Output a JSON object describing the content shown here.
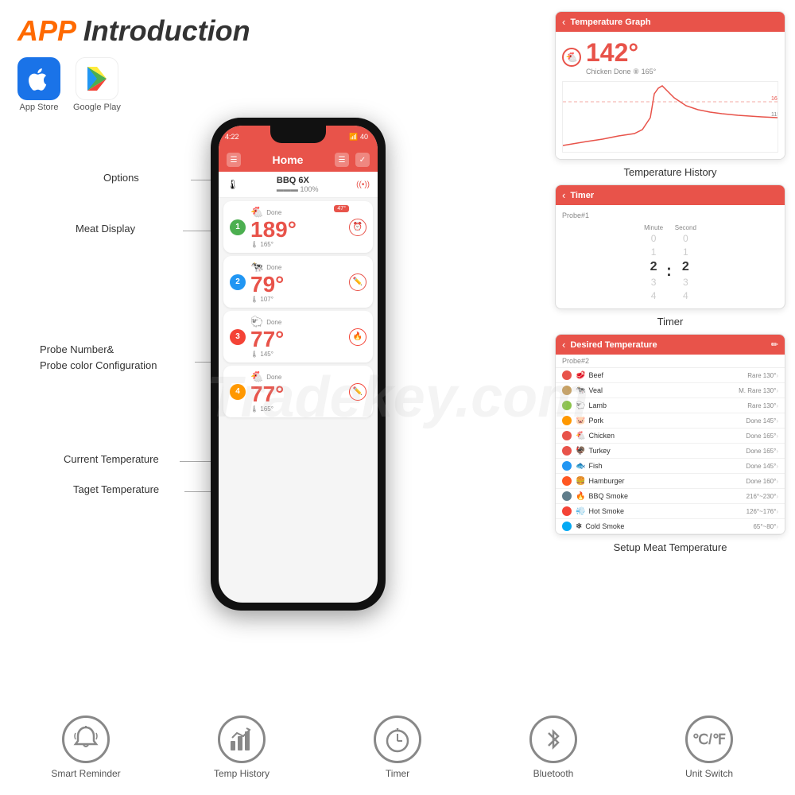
{
  "header": {
    "title_app": "APP",
    "title_rest": " Introduction"
  },
  "stores": [
    {
      "id": "app-store",
      "label": "App Store",
      "icon": "🍎"
    },
    {
      "id": "google-play",
      "label": "Google Play",
      "icon": "▶"
    }
  ],
  "phone": {
    "status_time": "4:22",
    "signal": "40",
    "nav_title": "Home",
    "device_name": "BBQ 6X",
    "device_battery": "100%",
    "probes": [
      {
        "number": "1",
        "color": "green",
        "meat_icon": "🐔",
        "status": "Done",
        "temp": "189°",
        "target": "165°",
        "badge": "47°"
      },
      {
        "number": "2",
        "color": "blue",
        "meat_icon": "🐄",
        "status": "Done",
        "temp": "79°",
        "target": "107°",
        "badge": ""
      },
      {
        "number": "3",
        "color": "red",
        "meat_icon": "🐑",
        "status": "Done",
        "temp": "77°",
        "target": "145°",
        "badge": ""
      },
      {
        "number": "4",
        "color": "orange",
        "meat_icon": "🐔",
        "status": "Done",
        "temp": "77°",
        "target": "165°",
        "badge": ""
      }
    ]
  },
  "labels": {
    "options": "Options",
    "meat_display": "Meat Display",
    "probe_config": "Probe Number&\nProbe color Configuration",
    "current_temp": "Current Temperature",
    "target_temp": "Taget Temperature"
  },
  "temp_history": {
    "title": "Temperature Graph",
    "temp_value": "142°",
    "probe_label": "Chicken Done ⑧ 165°",
    "label": "Temperature History"
  },
  "timer": {
    "title": "Timer",
    "subtitle": "Probe#1",
    "minute_label": "Minute",
    "second_label": "Second",
    "wheel_minutes": [
      "0",
      "1",
      "2",
      "3",
      "4"
    ],
    "wheel_seconds": [
      "0",
      "1",
      "2",
      "3",
      "4"
    ],
    "label": "Timer"
  },
  "desired_temp": {
    "title": "Desired Temperature",
    "subtitle": "Probe#2",
    "meats": [
      {
        "name": "Beef",
        "temp": "Rare 130°",
        "color": "#e8534a",
        "icon": "🥩"
      },
      {
        "name": "Veal",
        "temp": "M. Rare 130°",
        "color": "#c8a060",
        "icon": "🐄"
      },
      {
        "name": "Lamb",
        "temp": "Rare 130°",
        "color": "#8bc34a",
        "icon": "🐑"
      },
      {
        "name": "Pork",
        "temp": "Done 145°",
        "color": "#ff9800",
        "icon": "🐷"
      },
      {
        "name": "Chicken",
        "temp": "Done 165°",
        "color": "#e8534a",
        "icon": "🐔"
      },
      {
        "name": "Turkey",
        "temp": "Done 165°",
        "color": "#e8534a",
        "icon": "🦃"
      },
      {
        "name": "Fish",
        "temp": "Done 145°",
        "color": "#2196f3",
        "icon": "🐟"
      },
      {
        "name": "Hamburger",
        "temp": "Done 160°",
        "color": "#ff5722",
        "icon": "🍔"
      },
      {
        "name": "BBQ Smoke",
        "temp": "216°~230°",
        "color": "#607d8b",
        "icon": "🔥"
      },
      {
        "name": "Hot Smoke",
        "temp": "126°~176°",
        "color": "#f44336",
        "icon": "💨"
      },
      {
        "name": "Cold Smoke",
        "temp": "65°~80°",
        "color": "#03a9f4",
        "icon": "❄"
      }
    ],
    "label": "Setup Meat Temperature"
  },
  "bottom_icons": [
    {
      "id": "smart-reminder",
      "icon": "🔔",
      "label": "Smart Reminder"
    },
    {
      "id": "temp-history",
      "icon": "📊",
      "label": "Temp History"
    },
    {
      "id": "timer",
      "icon": "⏱",
      "label": "Timer"
    },
    {
      "id": "bluetooth",
      "icon": "⚡",
      "label": "Bluetooth"
    },
    {
      "id": "unit-switch",
      "icon": "℃/℉",
      "label": "Unit Switch"
    }
  ],
  "watermark": "Tradekey.com"
}
